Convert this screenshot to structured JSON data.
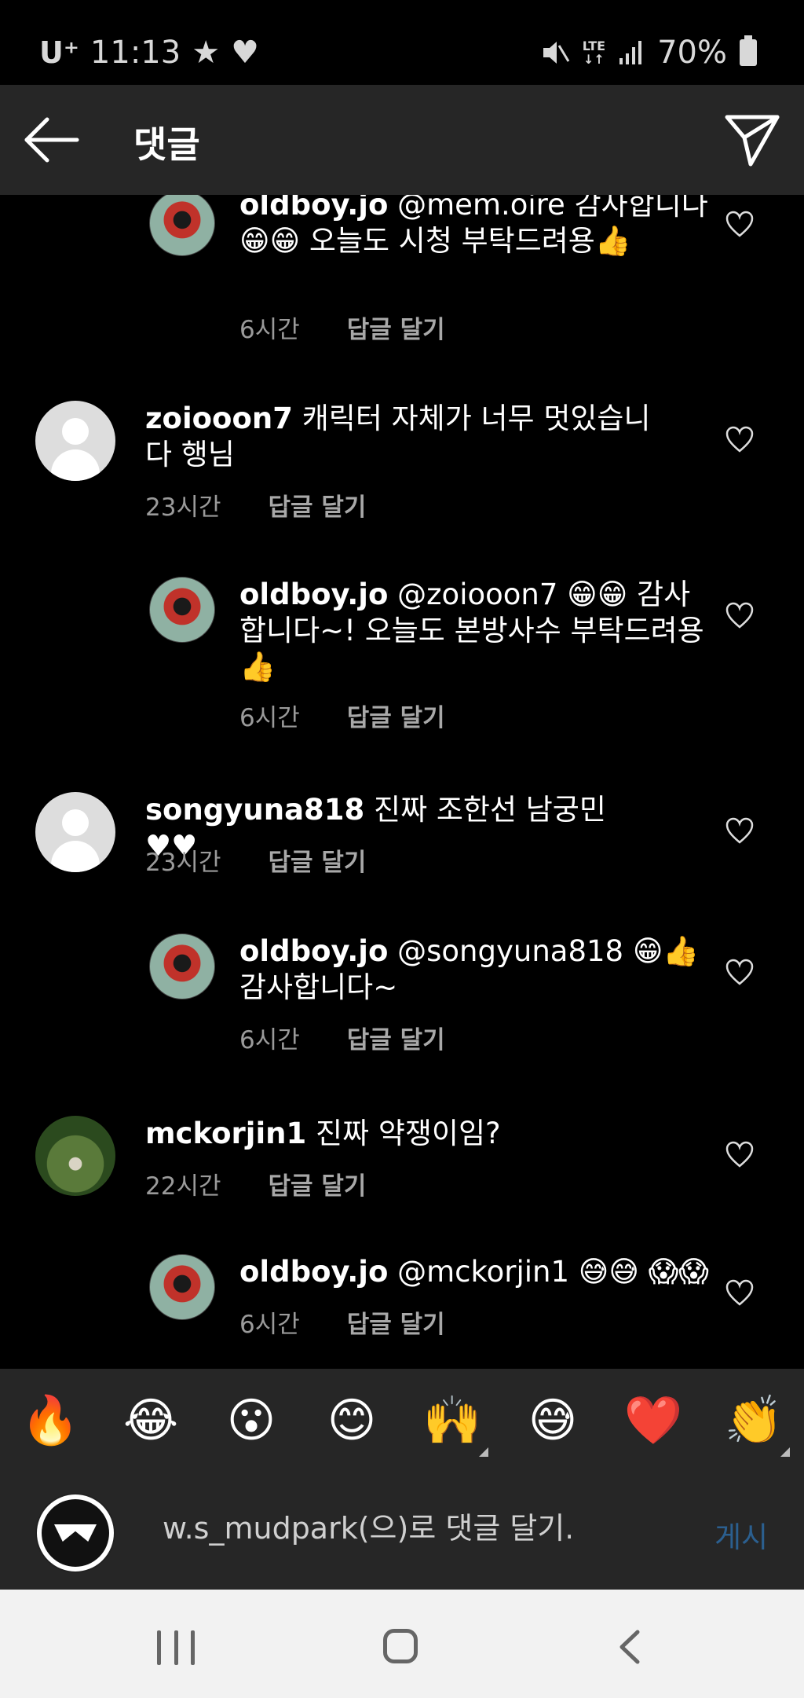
{
  "status_bar": {
    "carrier": "U⁺",
    "time": "11:13",
    "network": "LTE",
    "battery": "70%",
    "icons": [
      "star-icon",
      "heart-icon",
      "mute-icon",
      "signal-icon",
      "battery-icon"
    ]
  },
  "header": {
    "title": "댓글",
    "icons": [
      "back-arrow-icon",
      "send-icon"
    ]
  },
  "comments": [
    {
      "username": "oldboy.jo",
      "text": " @mem.oire 감사합니다😁😁 오늘도 시청 부탁드려용👍",
      "time": "6시간",
      "reply_label": "답글 달기",
      "avatar": "profile-photo",
      "is_reply": true
    },
    {
      "username": "zoiooon7",
      "text": " 캐릭터 자체가 너무 멋있습니다 행님",
      "time": "23시간",
      "reply_label": "답글 달기",
      "avatar": "default-avatar",
      "is_reply": false
    },
    {
      "username": "oldboy.jo",
      "text": " @zoiooon7 😁😁 감사합니다~! 오늘도 본방사수 부탁드려용👍",
      "time": "6시간",
      "reply_label": "답글 달기",
      "avatar": "profile-photo",
      "is_reply": true
    },
    {
      "username": "songyuna818",
      "text": " 진짜 조한선 남궁민 ♥♥",
      "time": "23시간",
      "reply_label": "답글 달기",
      "avatar": "default-avatar",
      "is_reply": false
    },
    {
      "username": "oldboy.jo",
      "text": " @songyuna818 😁👍 감사합니다~",
      "time": "6시간",
      "reply_label": "답글 달기",
      "avatar": "profile-photo",
      "is_reply": true
    },
    {
      "username": "mckorjin1",
      "text": " 진짜 약쟁이임?",
      "time": "22시간",
      "reply_label": "답글 달기",
      "avatar": "profile-photo",
      "is_reply": false
    },
    {
      "username": "oldboy.jo",
      "text": " @mckorjin1 😅😅 😱😱",
      "time": "6시간",
      "reply_label": "답글 달기",
      "avatar": "profile-photo",
      "is_reply": true
    }
  ],
  "emoji_bar": [
    "🔥",
    "😂",
    "😮",
    "😊",
    "🙌",
    "😅",
    "❤️",
    "👏"
  ],
  "input": {
    "placeholder": "w.s_mudpark(으)로 댓글 달기...",
    "post_label": "게시"
  },
  "colors": {
    "background": "#000000",
    "bar": "#262626",
    "meta_text": "#9a9a9a",
    "post_button": "#2b5f8f",
    "navbar": "#f2f2f2"
  }
}
